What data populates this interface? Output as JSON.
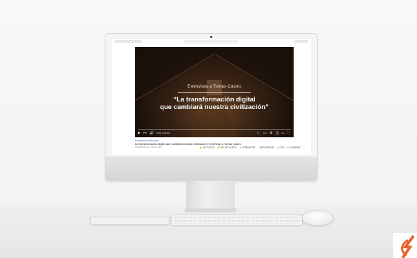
{
  "browser": {
    "title_bar": ""
  },
  "video": {
    "interview_label": "Entrevista a Tomás Castro",
    "quote_line1": "“La transformación digital",
    "quote_line2": "que cambiará nuestra civilización”",
    "time_display": "0:00 / 20:43",
    "progress": 0.0
  },
  "below_video": {
    "channel_line": "Entrevista de Educación",
    "title": "La transformación digital que cambiará nuestra civilización | Entrevista a Tomás Castro",
    "views_line": "Visualizaciones · hace meses",
    "actions": [
      {
        "icon": "thumb-up-icon",
        "label": "ME GUSTA"
      },
      {
        "icon": "thumb-down-icon",
        "label": "NO ME GUSTA"
      },
      {
        "icon": "share-icon",
        "label": "COMPARTIR"
      },
      {
        "icon": "download-icon",
        "label": "DESCARGAR"
      },
      {
        "icon": "clip-icon",
        "label": "CLIP"
      },
      {
        "icon": "save-icon",
        "label": "GUARDAR"
      },
      {
        "icon": "more-icon",
        "label": "···"
      }
    ]
  },
  "colors": {
    "accent_logo": "#e8622b",
    "link_blue": "#3b6fb6"
  }
}
